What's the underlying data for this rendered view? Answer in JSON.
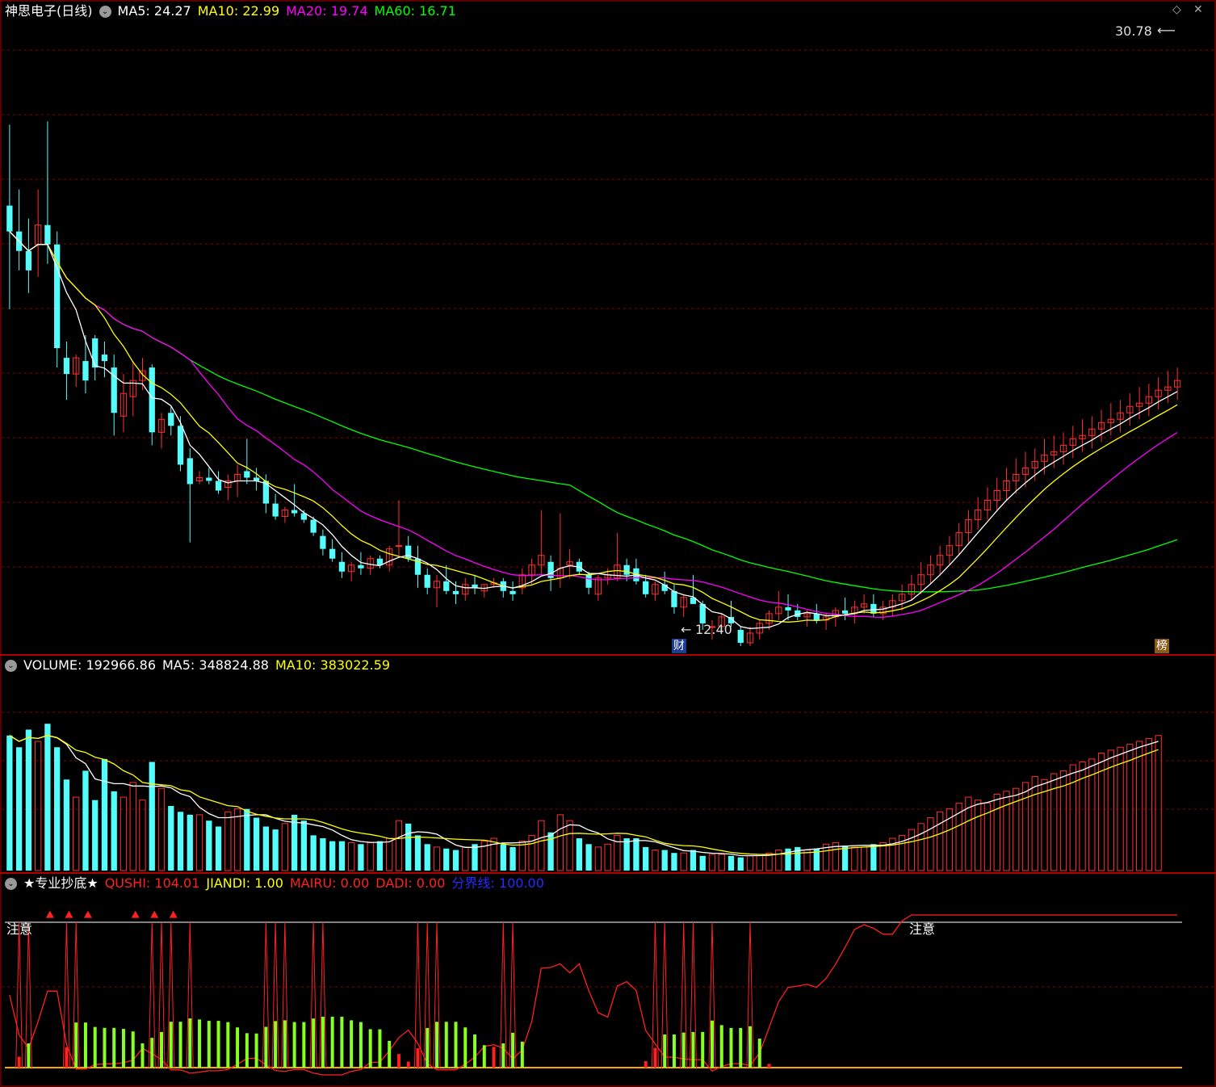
{
  "stock": {
    "name": "神思电子",
    "period": "(日线)"
  },
  "price_header": [
    {
      "label": "MA5: 24.27",
      "color": "#ffffff"
    },
    {
      "label": "MA10: 22.99",
      "color": "#ffff00"
    },
    {
      "label": "MA20: 19.74",
      "color": "#ff00ff"
    },
    {
      "label": "MA60: 16.71",
      "color": "#00ff00"
    }
  ],
  "volume_header": [
    {
      "label": "VOLUME: 192966.86",
      "color": "#ffffff"
    },
    {
      "label": "MA5: 348824.88",
      "color": "#ffffff"
    },
    {
      "label": "MA10: 383022.59",
      "color": "#ffff00"
    }
  ],
  "indicator_header": {
    "name": "★专业抄底★",
    "items": [
      {
        "label": "QUSHI: 104.01",
        "color": "#ff2020"
      },
      {
        "label": "JIANDI: 1.00",
        "color": "#ffff00"
      },
      {
        "label": "MAIRU: 0.00",
        "color": "#ff2020"
      },
      {
        "label": "DADI: 0.00",
        "color": "#ff2020"
      },
      {
        "label": "分界线: 100.00",
        "color": "#2828ff"
      }
    ]
  },
  "annotations": {
    "high": "30.78",
    "low": "12.40",
    "tag_cai": "财",
    "tag_bang": "榜",
    "notice_left": "注意",
    "notice_right": "注意"
  },
  "colors": {
    "up": "#ff3030",
    "down": "#54fcfc",
    "grid": "#8b0000",
    "border": "#b00000",
    "ma5": "#ffffff",
    "ma10": "#ffff00",
    "ma20": "#ff00ff",
    "ma60": "#00ff00"
  },
  "chart_data": {
    "type": "candlestick",
    "price_scale": [
      12.2,
      31.8
    ],
    "volume_scale": [
      0,
      660000
    ],
    "indicator_scale": [
      -10,
      120
    ],
    "divider_level": 100,
    "candles": [
      [
        26.0,
        28.5,
        22.8,
        25.2
      ],
      [
        25.2,
        26.5,
        24.0,
        24.6
      ],
      [
        24.6,
        25.6,
        23.3,
        24.0
      ],
      [
        24.8,
        26.5,
        23.8,
        25.4
      ],
      [
        25.4,
        28.6,
        24.2,
        24.8
      ],
      [
        24.8,
        25.2,
        21.0,
        21.6
      ],
      [
        21.3,
        21.8,
        20.0,
        20.8
      ],
      [
        20.8,
        21.4,
        20.4,
        21.3
      ],
      [
        21.2,
        22.0,
        20.2,
        20.6
      ],
      [
        21.9,
        22.0,
        20.6,
        21.0
      ],
      [
        21.4,
        21.8,
        20.7,
        21.2
      ],
      [
        21.0,
        21.4,
        18.9,
        19.6
      ],
      [
        19.5,
        20.8,
        19.0,
        20.2
      ],
      [
        20.1,
        21.2,
        19.5,
        20.6
      ],
      [
        20.6,
        21.3,
        20.3,
        20.9
      ],
      [
        21.0,
        21.1,
        18.6,
        19.0
      ],
      [
        19.0,
        19.6,
        18.5,
        19.4
      ],
      [
        19.6,
        19.8,
        18.9,
        19.2
      ],
      [
        19.2,
        19.5,
        17.8,
        18.0
      ],
      [
        18.2,
        18.5,
        15.6,
        17.4
      ],
      [
        17.5,
        17.8,
        17.4,
        17.6
      ],
      [
        17.6,
        17.9,
        17.4,
        17.5
      ],
      [
        17.5,
        17.8,
        17.1,
        17.2
      ],
      [
        17.3,
        17.7,
        16.9,
        17.5
      ],
      [
        17.5,
        18.0,
        17.0,
        17.7
      ],
      [
        17.8,
        18.8,
        17.4,
        17.6
      ],
      [
        17.6,
        17.9,
        17.2,
        17.5
      ],
      [
        17.5,
        17.7,
        16.5,
        16.8
      ],
      [
        16.8,
        17.1,
        16.3,
        16.4
      ],
      [
        16.4,
        16.7,
        16.2,
        16.6
      ],
      [
        16.6,
        17.4,
        16.4,
        16.5
      ],
      [
        16.5,
        16.6,
        16.2,
        16.3
      ],
      [
        16.3,
        16.4,
        15.8,
        15.9
      ],
      [
        15.8,
        16.0,
        15.2,
        15.4
      ],
      [
        15.4,
        15.7,
        15.0,
        15.1
      ],
      [
        15.0,
        15.3,
        14.5,
        14.7
      ],
      [
        14.7,
        15.0,
        14.4,
        14.9
      ],
      [
        14.9,
        15.3,
        14.6,
        14.8
      ],
      [
        14.8,
        15.2,
        14.6,
        15.1
      ],
      [
        15.1,
        15.2,
        14.8,
        14.9
      ],
      [
        14.9,
        15.5,
        14.7,
        15.4
      ],
      [
        15.5,
        16.9,
        15.2,
        15.5
      ],
      [
        15.5,
        15.8,
        15.0,
        15.1
      ],
      [
        15.1,
        15.5,
        14.2,
        14.6
      ],
      [
        14.6,
        14.8,
        14.0,
        14.2
      ],
      [
        14.2,
        14.6,
        13.6,
        14.4
      ],
      [
        14.4,
        14.9,
        14.0,
        14.1
      ],
      [
        14.1,
        14.4,
        13.7,
        14.0
      ],
      [
        14.0,
        14.5,
        13.8,
        14.3
      ],
      [
        14.3,
        14.6,
        14.0,
        14.2
      ],
      [
        14.1,
        14.3,
        13.9,
        14.3
      ],
      [
        14.3,
        14.5,
        14.2,
        14.35
      ],
      [
        14.4,
        14.5,
        13.9,
        14.1
      ],
      [
        14.1,
        14.4,
        13.8,
        14.0
      ],
      [
        14.2,
        14.8,
        14.0,
        14.6
      ],
      [
        14.6,
        15.1,
        14.3,
        14.9
      ],
      [
        14.9,
        16.6,
        14.6,
        15.2
      ],
      [
        15.0,
        15.2,
        14.1,
        14.5
      ],
      [
        14.5,
        16.5,
        14.2,
        14.8
      ],
      [
        14.9,
        15.4,
        14.5,
        15.0
      ],
      [
        15.0,
        15.1,
        14.6,
        14.7
      ],
      [
        14.6,
        14.7,
        14.0,
        14.2
      ],
      [
        14.0,
        14.6,
        13.8,
        14.5
      ],
      [
        14.5,
        14.8,
        14.3,
        14.6
      ],
      [
        14.5,
        15.9,
        14.4,
        14.9
      ],
      [
        14.9,
        15.1,
        14.4,
        14.6
      ],
      [
        14.8,
        15.1,
        14.3,
        14.4
      ],
      [
        14.4,
        14.6,
        13.9,
        14.0
      ],
      [
        14.0,
        14.4,
        13.8,
        14.3
      ],
      [
        14.3,
        14.7,
        14.0,
        14.1
      ],
      [
        14.1,
        14.3,
        13.4,
        13.6
      ],
      [
        13.6,
        14.0,
        13.3,
        13.9
      ],
      [
        13.9,
        14.6,
        13.7,
        13.7
      ],
      [
        13.7,
        13.8,
        12.9,
        13.1
      ],
      [
        13.0,
        13.2,
        12.6,
        13.0
      ],
      [
        13.0,
        13.4,
        12.8,
        13.3
      ],
      [
        13.3,
        13.8,
        13.0,
        13.1
      ],
      [
        12.9,
        13.0,
        12.4,
        12.5
      ],
      [
        12.5,
        13.0,
        12.4,
        12.8
      ],
      [
        12.8,
        13.2,
        12.6,
        13.1
      ],
      [
        13.1,
        13.5,
        12.9,
        13.4
      ],
      [
        13.4,
        14.1,
        13.2,
        13.6
      ],
      [
        13.6,
        14.0,
        13.2,
        13.5
      ],
      [
        13.5,
        13.7,
        13.2,
        13.3
      ],
      [
        13.3,
        13.5,
        13.0,
        13.4
      ],
      [
        13.4,
        13.7,
        13.1,
        13.2
      ],
      [
        13.2,
        13.4,
        12.9,
        13.3
      ],
      [
        13.3,
        13.6,
        13.0,
        13.5
      ],
      [
        13.5,
        13.9,
        13.2,
        13.4
      ],
      [
        13.4,
        13.8,
        13.1,
        13.6
      ],
      [
        13.6,
        14.0,
        13.4,
        13.7
      ],
      [
        13.7,
        14.0,
        13.3,
        13.4
      ],
      [
        13.4,
        13.8,
        13.2,
        13.6
      ],
      [
        13.6,
        14.0,
        13.3,
        13.8
      ],
      [
        13.8,
        14.3,
        13.5,
        14.0
      ],
      [
        14.0,
        14.6,
        13.8,
        14.3
      ],
      [
        14.3,
        15.0,
        14.0,
        14.6
      ],
      [
        14.6,
        15.2,
        14.3,
        14.9
      ],
      [
        14.9,
        15.5,
        14.6,
        15.2
      ],
      [
        15.2,
        15.8,
        14.9,
        15.5
      ],
      [
        15.5,
        16.2,
        15.2,
        15.9
      ],
      [
        15.9,
        16.6,
        15.6,
        16.3
      ],
      [
        16.3,
        17.0,
        16.0,
        16.6
      ],
      [
        16.6,
        17.3,
        16.3,
        16.9
      ],
      [
        16.9,
        17.6,
        16.6,
        17.2
      ],
      [
        17.2,
        17.9,
        16.9,
        17.5
      ],
      [
        17.5,
        18.2,
        17.1,
        17.7
      ],
      [
        17.7,
        18.4,
        17.3,
        17.9
      ],
      [
        17.9,
        18.5,
        17.5,
        18.1
      ],
      [
        18.1,
        18.8,
        17.7,
        18.3
      ],
      [
        18.3,
        18.9,
        17.9,
        18.4
      ],
      [
        18.4,
        19.0,
        18.0,
        18.6
      ],
      [
        18.6,
        19.2,
        18.2,
        18.8
      ],
      [
        18.8,
        19.4,
        18.4,
        18.9
      ],
      [
        18.9,
        19.5,
        18.5,
        19.1
      ],
      [
        19.1,
        19.7,
        18.7,
        19.3
      ],
      [
        19.3,
        19.9,
        18.9,
        19.4
      ],
      [
        19.4,
        20.0,
        19.0,
        19.6
      ],
      [
        19.6,
        20.2,
        19.2,
        19.8
      ],
      [
        19.8,
        20.4,
        19.4,
        19.9
      ],
      [
        19.9,
        20.5,
        19.5,
        20.1
      ],
      [
        20.1,
        20.7,
        19.7,
        20.3
      ],
      [
        20.3,
        20.9,
        19.9,
        20.4
      ],
      [
        20.4,
        21.0,
        20.0,
        20.6
      ]
    ],
    "volume": [
      460,
      420,
      480,
      440,
      500,
      420,
      310,
      250,
      340,
      240,
      380,
      270,
      250,
      300,
      240,
      370,
      280,
      220,
      200,
      190,
      190,
      170,
      150,
      200,
      210,
      210,
      180,
      150,
      140,
      160,
      190,
      170,
      120,
      110,
      100,
      100,
      95,
      90,
      95,
      100,
      110,
      170,
      160,
      120,
      90,
      80,
      75,
      70,
      80,
      90,
      100,
      110,
      90,
      80,
      100,
      120,
      170,
      130,
      190,
      170,
      110,
      90,
      80,
      90,
      120,
      110,
      110,
      80,
      70,
      70,
      60,
      60,
      70,
      50,
      55,
      55,
      50,
      45,
      50,
      55,
      60,
      70,
      75,
      80,
      70,
      75,
      90,
      95,
      85,
      80,
      80,
      90,
      95,
      110,
      120,
      140,
      160,
      180,
      200,
      210,
      230,
      250,
      240,
      230,
      260,
      270,
      280,
      300,
      320,
      310,
      330,
      340,
      360,
      370,
      380,
      400,
      410,
      420,
      430,
      440,
      450,
      460
    ]
  }
}
